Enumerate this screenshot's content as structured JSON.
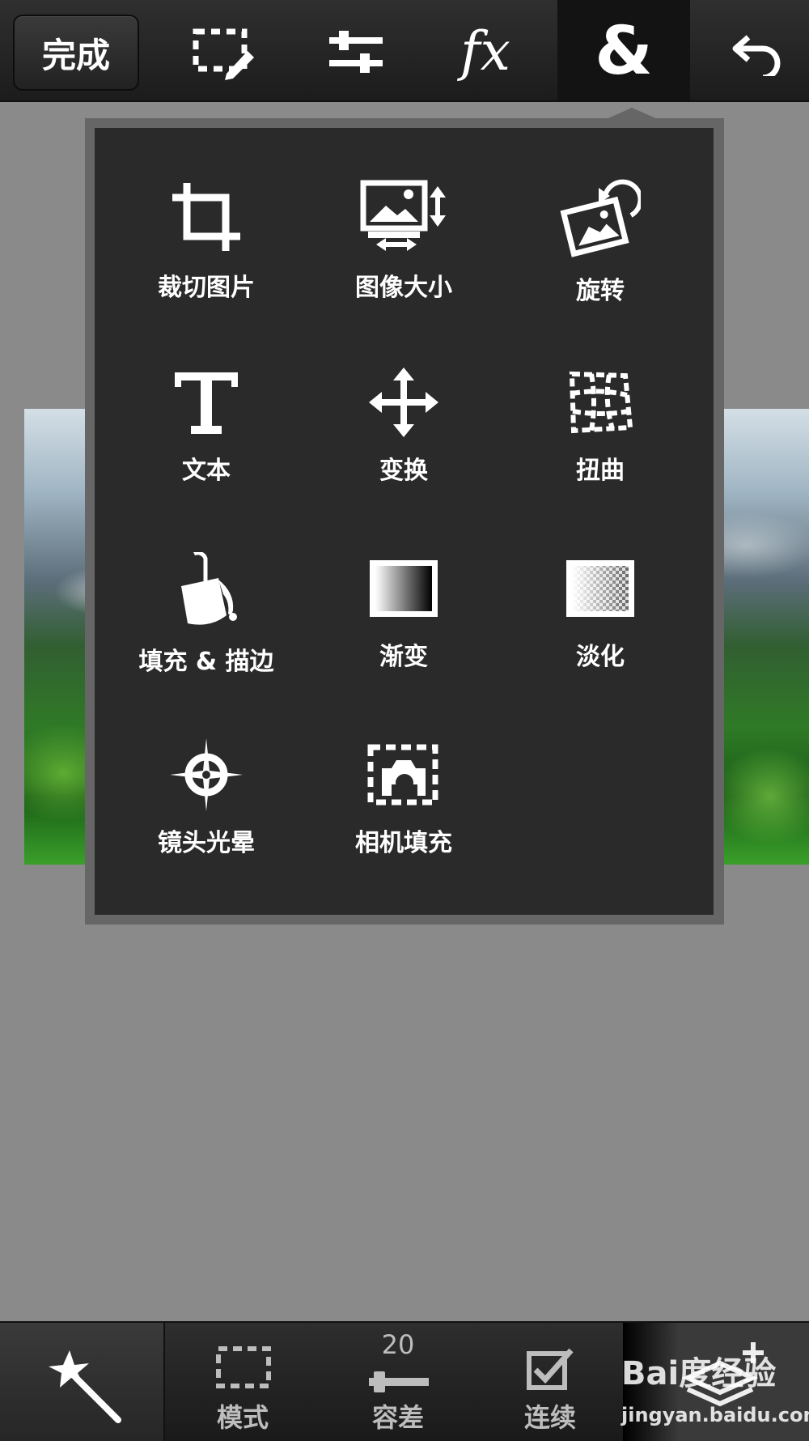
{
  "toolbar": {
    "done_label": "完成",
    "icons": [
      "selection-edit-icon",
      "adjustments-icon",
      "effects-fx-icon",
      "ampersand-icon",
      "undo-icon"
    ],
    "fx_text": "fx",
    "amp_text": "&"
  },
  "menu": {
    "items": [
      {
        "label": "裁切图片",
        "icon": "crop-icon"
      },
      {
        "label": "图像大小",
        "icon": "image-size-icon"
      },
      {
        "label": "旋转",
        "icon": "rotate-icon"
      },
      {
        "label": "文本",
        "icon": "text-icon"
      },
      {
        "label": "变换",
        "icon": "transform-icon"
      },
      {
        "label": "扭曲",
        "icon": "warp-icon"
      },
      {
        "label": "填充 & 描边",
        "icon": "fill-stroke-icon"
      },
      {
        "label": "渐变",
        "icon": "gradient-icon"
      },
      {
        "label": "淡化",
        "icon": "fade-icon"
      },
      {
        "label": "镜头光晕",
        "icon": "lens-flare-icon"
      },
      {
        "label": "相机填充",
        "icon": "camera-fill-icon"
      }
    ]
  },
  "bottom": {
    "mode_label": "模式",
    "tolerance_label": "容差",
    "tolerance_value": "20",
    "contiguous_label": "连续",
    "icons": [
      "magic-wand-icon",
      "marquee-mode-icon",
      "tolerance-slider-icon",
      "contiguous-check-icon",
      "add-layer-icon"
    ]
  },
  "watermark": {
    "logo_text": "Bai度经验",
    "url_text": "jingyan.baidu.com"
  }
}
